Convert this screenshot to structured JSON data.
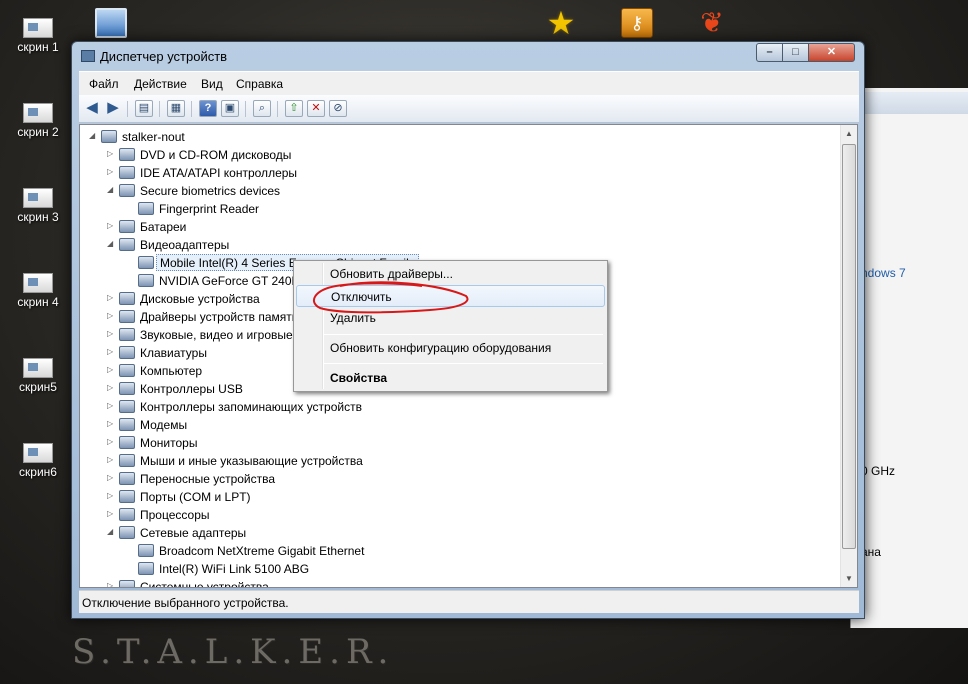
{
  "desktop": {
    "icons": [
      {
        "label": "скрин 1"
      },
      {
        "label": "скрин 2"
      },
      {
        "label": "скрин 3"
      },
      {
        "label": "скрин 4"
      },
      {
        "label": "скрин5"
      },
      {
        "label": "скрин6"
      }
    ],
    "logo": "S.T.A.L.K.E.R."
  },
  "background_window": {
    "text_os": "ndows 7",
    "text_ghz": "0 GHz",
    "text_ana": "ана"
  },
  "window": {
    "title": "Диспетчер устройств",
    "menu": [
      "Файл",
      "Действие",
      "Вид",
      "Справка"
    ],
    "status": "Отключение выбранного устройства."
  },
  "tree": {
    "root": "stalker-nout",
    "items": [
      {
        "label": "DVD и CD-ROM дисководы",
        "icon": "dvd-drive-icon"
      },
      {
        "label": "IDE ATA/ATAPI контроллеры",
        "icon": "ide-controller-icon"
      },
      {
        "label": "Secure biometrics devices",
        "icon": "biometric-icon"
      },
      {
        "label": "Fingerprint Reader",
        "icon": "fingerprint-icon"
      },
      {
        "label": "Батареи",
        "icon": "battery-icon"
      },
      {
        "label": "Видеоадаптеры",
        "icon": "display-adapter-icon"
      },
      {
        "label": "Mobile Intel(R) 4 Series Express Chipset Family",
        "icon": "display-adapter-icon"
      },
      {
        "label": "NVIDIA GeForce GT 240M",
        "icon": "display-adapter-icon"
      },
      {
        "label": "Дисковые устройства",
        "icon": "disk-drive-icon"
      },
      {
        "label": "Драйверы устройств памяти",
        "icon": "memory-driver-icon"
      },
      {
        "label": "Звуковые, видео и игровые устройства",
        "icon": "sound-icon"
      },
      {
        "label": "Клавиатуры",
        "icon": "keyboard-icon"
      },
      {
        "label": "Компьютер",
        "icon": "computer-icon"
      },
      {
        "label": "Контроллеры USB",
        "icon": "usb-icon"
      },
      {
        "label": "Контроллеры запоминающих устройств",
        "icon": "storage-controller-icon"
      },
      {
        "label": "Модемы",
        "icon": "modem-icon"
      },
      {
        "label": "Мониторы",
        "icon": "monitor-icon"
      },
      {
        "label": "Мыши и иные указывающие устройства",
        "icon": "mouse-icon"
      },
      {
        "label": "Переносные устройства",
        "icon": "portable-device-icon"
      },
      {
        "label": "Порты (COM и LPT)",
        "icon": "port-icon"
      },
      {
        "label": "Процессоры",
        "icon": "processor-icon"
      },
      {
        "label": "Сетевые адаптеры",
        "icon": "network-adapter-icon"
      },
      {
        "label": "Broadcom NetXtreme Gigabit Ethernet",
        "icon": "network-adapter-icon"
      },
      {
        "label": "Intel(R) WiFi Link 5100 ABG",
        "icon": "network-adapter-icon"
      },
      {
        "label": "Системные устройства",
        "icon": "system-device-icon"
      }
    ]
  },
  "context_menu": {
    "items": [
      "Обновить драйверы...",
      "Отключить",
      "Удалить",
      "Обновить конфигурацию оборудования",
      "Свойства"
    ]
  }
}
